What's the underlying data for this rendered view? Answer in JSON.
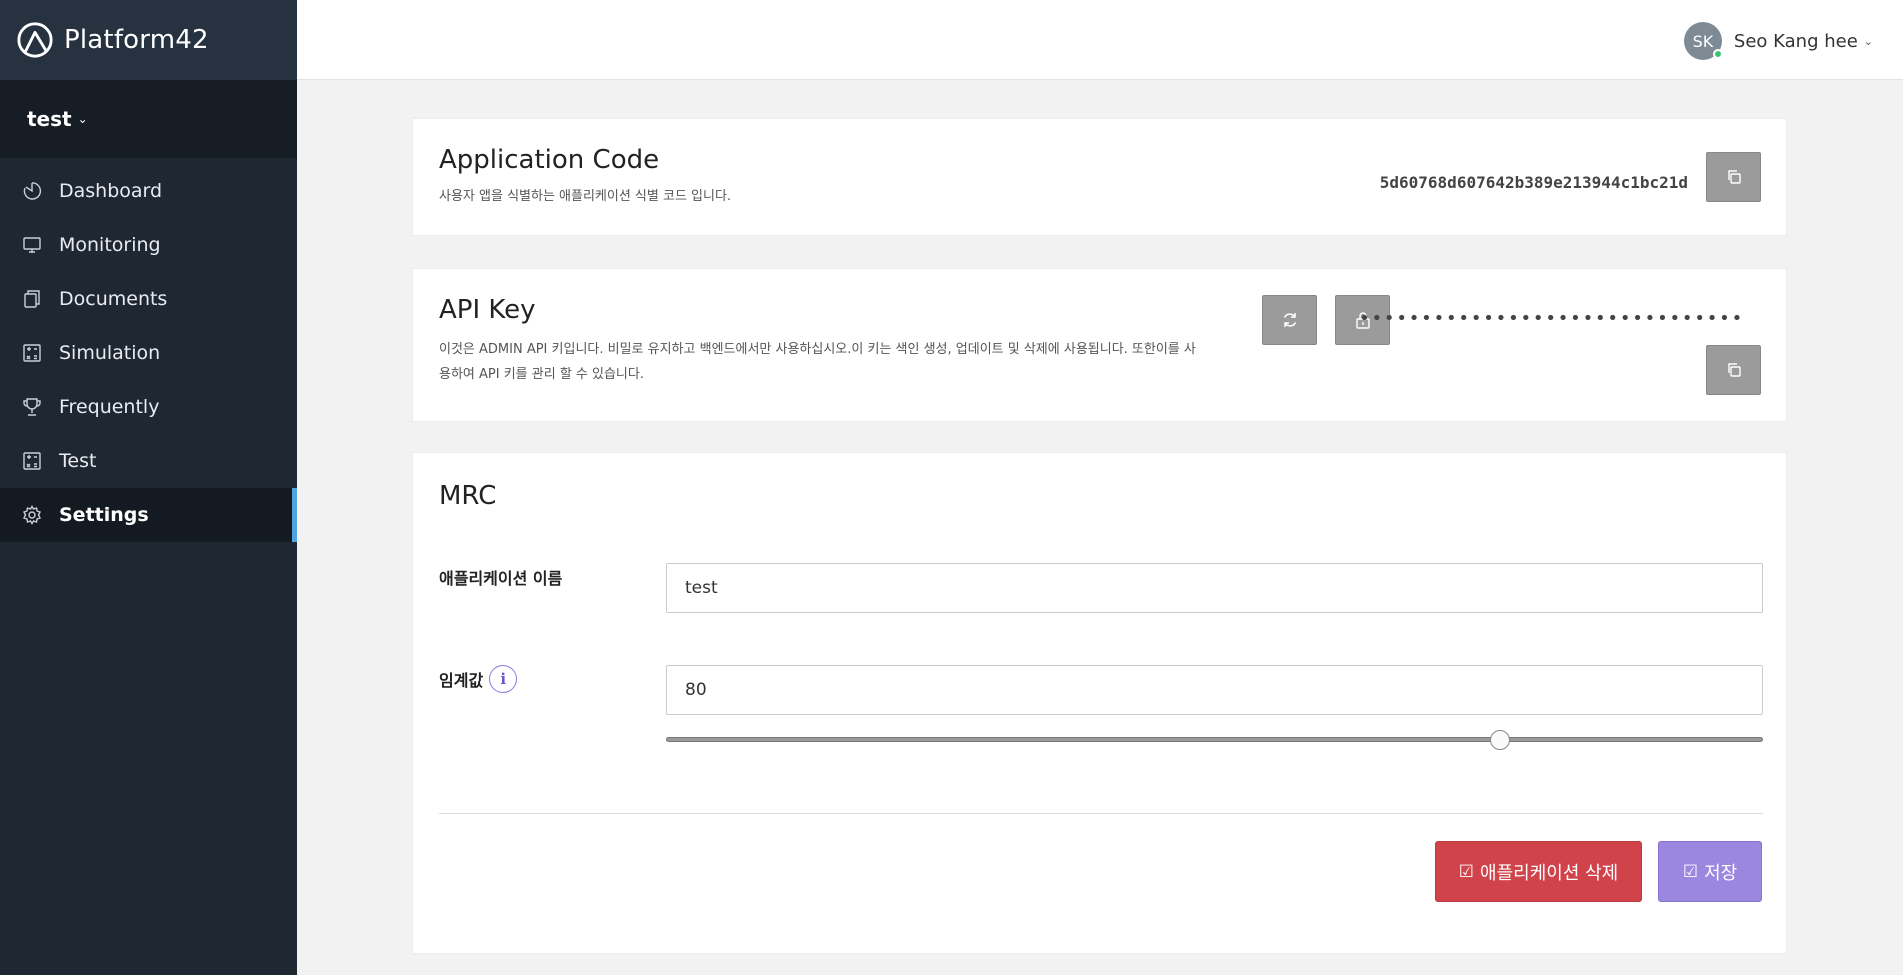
{
  "brand": {
    "name": "Platform42"
  },
  "project": {
    "name": "test"
  },
  "sidebar": {
    "items": [
      {
        "label": "Dashboard",
        "icon": "dashboard-icon"
      },
      {
        "label": "Monitoring",
        "icon": "monitor-icon"
      },
      {
        "label": "Documents",
        "icon": "documents-icon"
      },
      {
        "label": "Simulation",
        "icon": "calculator-icon"
      },
      {
        "label": "Frequently",
        "icon": "trophy-icon"
      },
      {
        "label": "Test",
        "icon": "calculator-icon"
      },
      {
        "label": "Settings",
        "icon": "gear-icon",
        "active": true
      }
    ]
  },
  "user": {
    "initials": "SK",
    "name": "Seo Kang hee",
    "status_color": "#3bc46f"
  },
  "app_code": {
    "title": "Application Code",
    "description": "사용자 앱을 식별하는 애플리케이션 식별 코드 입니다.",
    "code": "5d60768d607642b389e213944c1bc21d"
  },
  "api_key": {
    "title": "API Key",
    "description": "이것은 ADMIN API 키입니다. 비밀로 유지하고 백엔드에서만 사용하십시오.이 키는 색인 생성, 업데이트 및 삭제에 사용됩니다. 또한이를 사용하여 API 키를 관리 할 수 있습니다.",
    "masked_value": "•••••••••••••••••••••••••••••••"
  },
  "mrc": {
    "title": "MRC",
    "app_name_label": "애플리케이션 이름",
    "app_name_value": "test",
    "threshold_label": "임계값",
    "threshold_value": "80",
    "threshold_slider_fraction": 0.76,
    "delete_label": "애플리케이션 삭제",
    "save_label": "저장"
  },
  "colors": {
    "sidebar_bg": "#1f2732",
    "active_accent": "#4fa3e0",
    "danger": "#d0434a",
    "primary": "#9b86e0"
  }
}
